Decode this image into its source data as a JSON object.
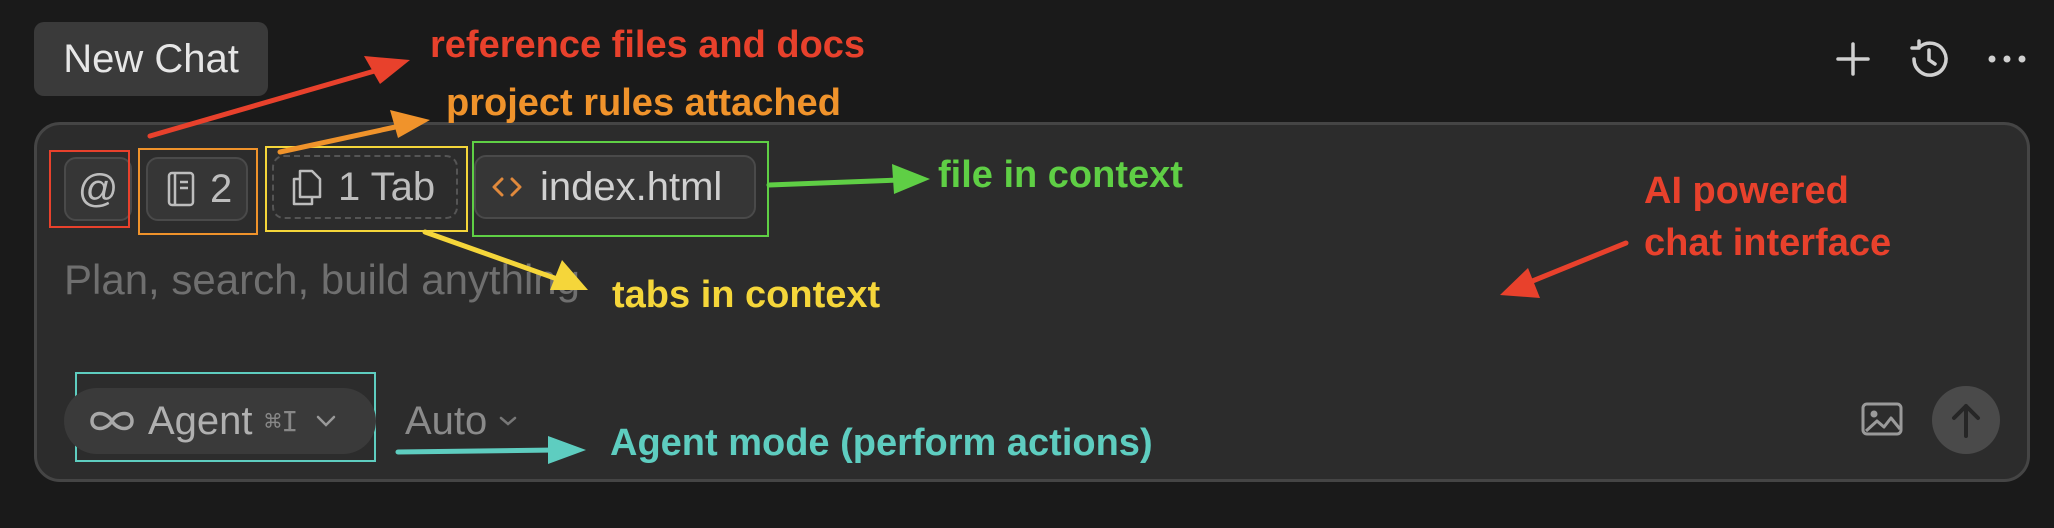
{
  "header": {
    "tab_label": "New Chat",
    "actions": [
      {
        "name": "new-chat",
        "icon": "plus-icon"
      },
      {
        "name": "history",
        "icon": "history-icon"
      },
      {
        "name": "more",
        "icon": "ellipsis-icon"
      }
    ]
  },
  "context_bar": {
    "mention_symbol": "@",
    "rules_count": "2",
    "tabs_label": "1 Tab",
    "file_label": "index.html"
  },
  "composer": {
    "placeholder": "Plan, search, build anything"
  },
  "footer": {
    "mode_label": "Agent",
    "mode_shortcut": "⌘I",
    "model_label": "Auto"
  },
  "annotations": {
    "reference": "reference files and docs",
    "rules": "project rules attached",
    "file": "file in context",
    "tabs": "tabs in context",
    "ai_line1": "AI powered",
    "ai_line2": "chat interface",
    "agent": "Agent mode (perform actions)"
  },
  "colors": {
    "red": "#e8412c",
    "orange": "#f0932b",
    "green": "#5fcf45",
    "yellow": "#f5d63a",
    "teal": "#5ecdc0",
    "file_icon": "#e0893c"
  }
}
